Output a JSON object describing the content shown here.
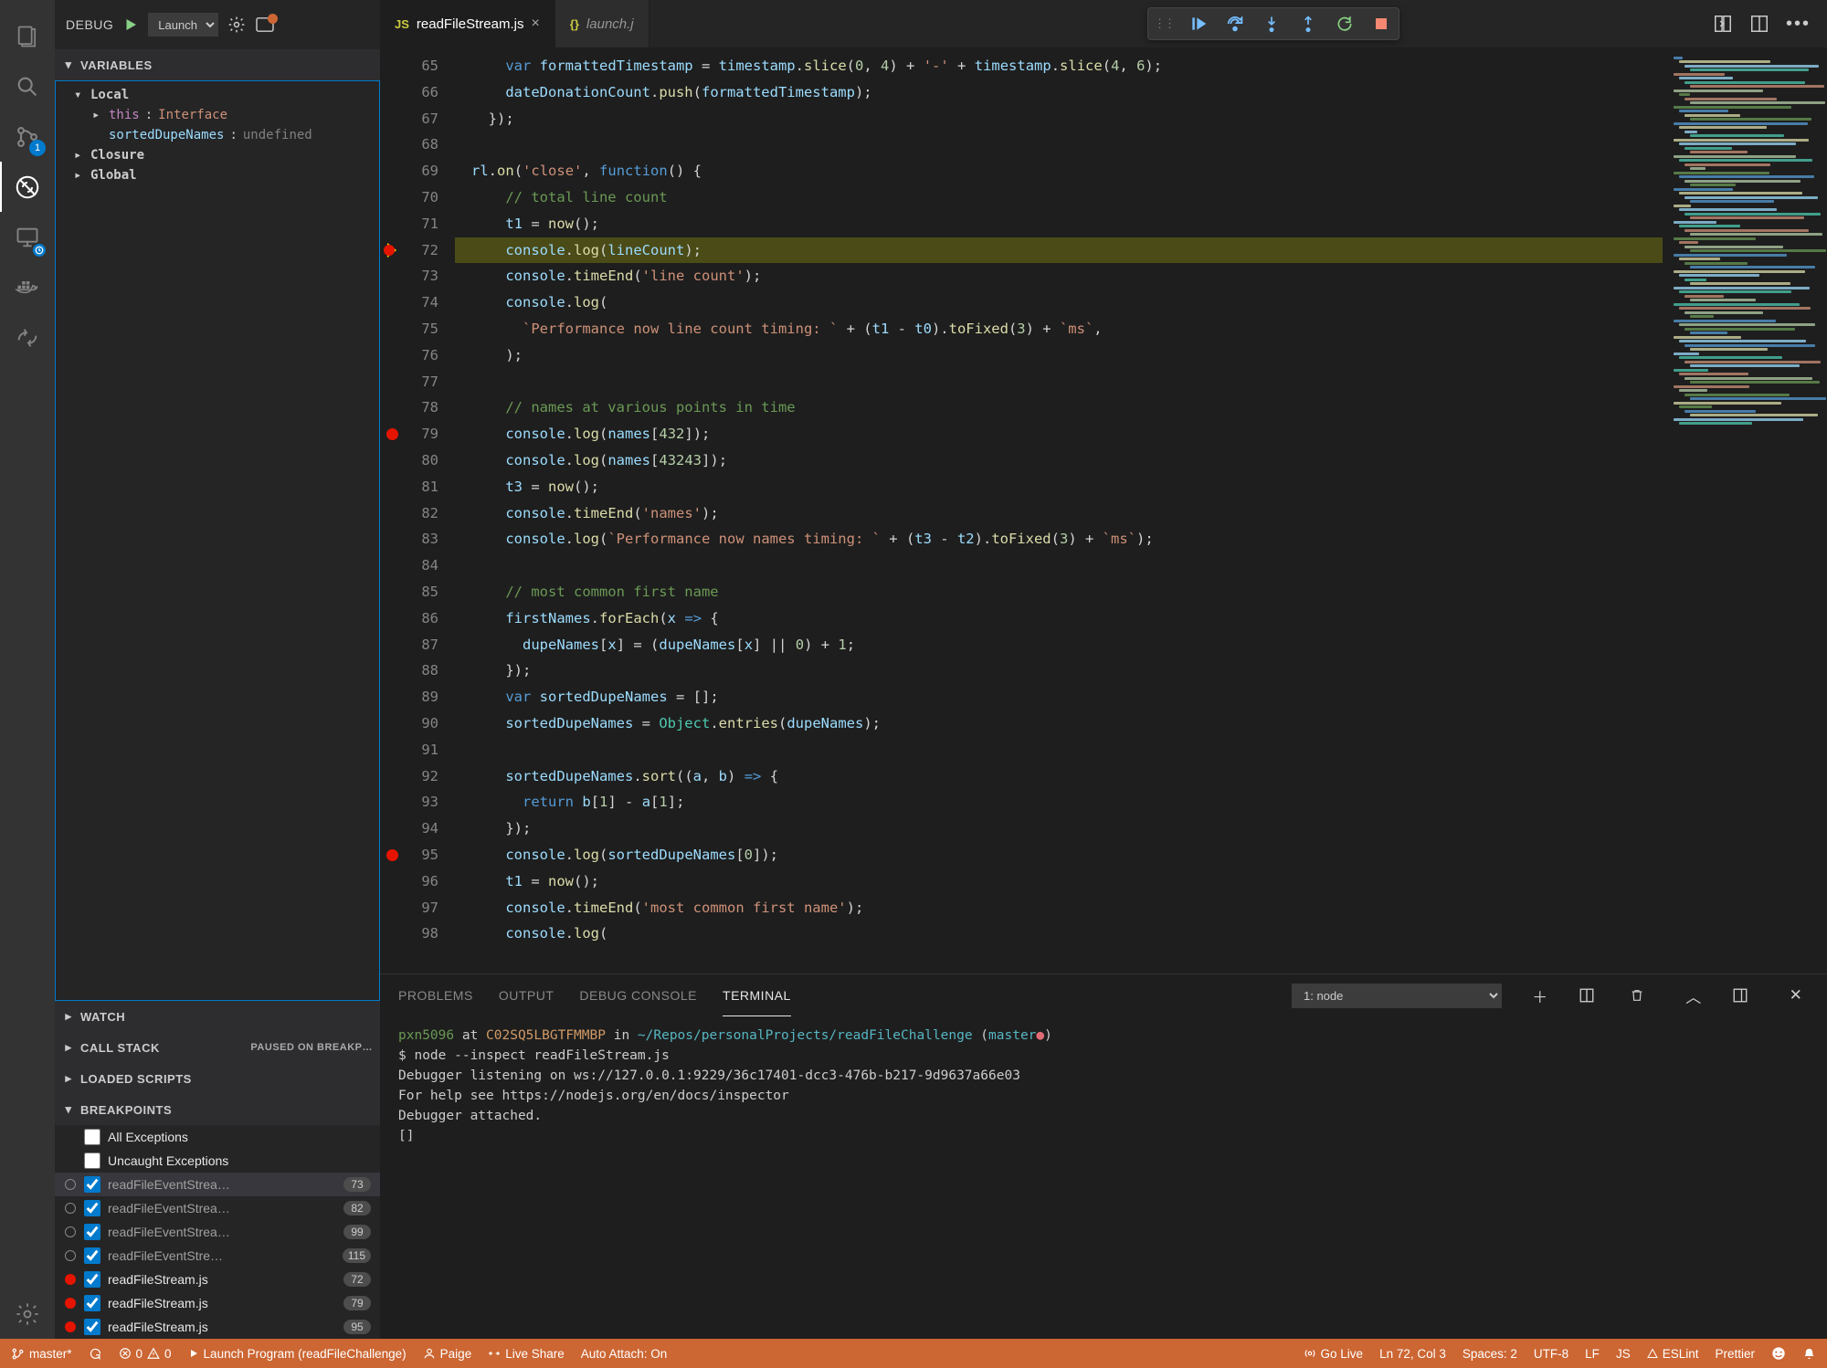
{
  "debugToolbar": {
    "label": "DEBUG",
    "config": "Launch",
    "iconGear": "gear",
    "iconBreak": "breakpoint"
  },
  "sections": {
    "variables": "VARIABLES",
    "watch": "WATCH",
    "callstack": "CALL STACK",
    "callstack_status": "PAUSED ON BREAKP…",
    "loaded": "LOADED SCRIPTS",
    "breakpoints": "BREAKPOINTS"
  },
  "variables": {
    "scopes": [
      {
        "name": "Local",
        "items": [
          {
            "k": "this",
            "v": "Interface",
            "kcls": "var-key2",
            "vcls": "var-val",
            "expandable": true
          },
          {
            "k": "sortedDupeNames",
            "v": "undefined",
            "kcls": "var-key",
            "vcls": "var-und",
            "expandable": false
          }
        ]
      },
      {
        "name": "Closure"
      },
      {
        "name": "Global"
      }
    ]
  },
  "bp_builtin": [
    {
      "label": "All Exceptions",
      "checked": false
    },
    {
      "label": "Uncaught Exceptions",
      "checked": false
    }
  ],
  "breakpoints": [
    {
      "file": "readFileEventStrea…",
      "line": "73",
      "dot": "hollow",
      "sel": true
    },
    {
      "file": "readFileEventStrea…",
      "line": "82",
      "dot": "hollow"
    },
    {
      "file": "readFileEventStrea…",
      "line": "99",
      "dot": "hollow"
    },
    {
      "file": "readFileEventStre…",
      "line": "115",
      "dot": "hollow"
    },
    {
      "file": "readFileStream.js",
      "line": "72",
      "dot": "red",
      "active": true
    },
    {
      "file": "readFileStream.js",
      "line": "79",
      "dot": "red",
      "active": true
    },
    {
      "file": "readFileStream.js",
      "line": "95",
      "dot": "red",
      "active": true
    }
  ],
  "tabs": [
    {
      "icon": "JS",
      "label": "readFileStream.js",
      "active": true,
      "close": true
    },
    {
      "icon": "{}",
      "label": "launch.j",
      "active": false
    }
  ],
  "debugControls": [
    "continue",
    "step-over",
    "step-into",
    "step-out",
    "restart",
    "stop"
  ],
  "lineStart": 65,
  "currentLine": 72,
  "bpLines": [
    79,
    95
  ],
  "code": [
    "    <span class='tok-kw'>var</span> <span class='tok-var'>formattedTimestamp</span> = <span class='tok-var'>timestamp</span>.<span class='tok-fn'>slice</span>(<span class='tok-num'>0</span>, <span class='tok-num'>4</span>) + <span class='tok-str'>'-'</span> + <span class='tok-var'>timestamp</span>.<span class='tok-fn'>slice</span>(<span class='tok-num'>4</span>, <span class='tok-num'>6</span>);",
    "    <span class='tok-var'>dateDonationCount</span>.<span class='tok-fn'>push</span>(<span class='tok-var'>formattedTimestamp</span>);",
    "  });",
    "",
    "<span class='tok-var'>rl</span>.<span class='tok-fn'>on</span>(<span class='tok-str'>'close'</span>, <span class='tok-kw'>function</span>() {",
    "    <span class='tok-com'>// total line count</span>",
    "    <span class='tok-var'>t1</span> = <span class='tok-fn'>now</span>();",
    "    <span class='tok-var'>console</span>.<span class='tok-fn'>log</span>(<span class='tok-var'>lineCount</span>);",
    "    <span class='tok-var'>console</span>.<span class='tok-fn'>timeEnd</span>(<span class='tok-str'>'line count'</span>);",
    "    <span class='tok-var'>console</span>.<span class='tok-fn'>log</span>(",
    "      <span class='tok-str'>`Performance now line count timing: `</span> + (<span class='tok-var'>t1</span> - <span class='tok-var'>t0</span>).<span class='tok-fn'>toFixed</span>(<span class='tok-num'>3</span>) + <span class='tok-str'>`ms`</span>,",
    "    );",
    "",
    "    <span class='tok-com'>// names at various points in time</span>",
    "    <span class='tok-var'>console</span>.<span class='tok-fn'>log</span>(<span class='tok-var'>names</span>[<span class='tok-num'>432</span>]);",
    "    <span class='tok-var'>console</span>.<span class='tok-fn'>log</span>(<span class='tok-var'>names</span>[<span class='tok-num'>43243</span>]);",
    "    <span class='tok-var'>t3</span> = <span class='tok-fn'>now</span>();",
    "    <span class='tok-var'>console</span>.<span class='tok-fn'>timeEnd</span>(<span class='tok-str'>'names'</span>);",
    "    <span class='tok-var'>console</span>.<span class='tok-fn'>log</span>(<span class='tok-str'>`Performance now names timing: `</span> + (<span class='tok-var'>t3</span> - <span class='tok-var'>t2</span>).<span class='tok-fn'>toFixed</span>(<span class='tok-num'>3</span>) + <span class='tok-str'>`ms`</span>);",
    "",
    "    <span class='tok-com'>// most common first name</span>",
    "    <span class='tok-var'>firstNames</span>.<span class='tok-fn'>forEach</span>(<span class='tok-var'>x</span> <span class='tok-arrow'>=&gt;</span> {",
    "      <span class='tok-var'>dupeNames</span>[<span class='tok-var'>x</span>] = (<span class='tok-var'>dupeNames</span>[<span class='tok-var'>x</span>] || <span class='tok-num'>0</span>) + <span class='tok-num'>1</span>;",
    "    });",
    "    <span class='tok-kw'>var</span> <span class='tok-var'>sortedDupeNames</span> = [];",
    "    <span class='tok-var'>sortedDupeNames</span> = <span class='tok-cls'>Object</span>.<span class='tok-fn'>entries</span>(<span class='tok-var'>dupeNames</span>);",
    "",
    "    <span class='tok-var'>sortedDupeNames</span>.<span class='tok-fn'>sort</span>((<span class='tok-var'>a</span>, <span class='tok-var'>b</span>) <span class='tok-arrow'>=&gt;</span> {",
    "      <span class='tok-kw'>return</span> <span class='tok-var'>b</span>[<span class='tok-num'>1</span>] - <span class='tok-var'>a</span>[<span class='tok-num'>1</span>];",
    "    });",
    "    <span class='tok-var'>console</span>.<span class='tok-fn'>log</span>(<span class='tok-var'>sortedDupeNames</span>[<span class='tok-num'>0</span>]);",
    "    <span class='tok-var'>t1</span> = <span class='tok-fn'>now</span>();",
    "    <span class='tok-var'>console</span>.<span class='tok-fn'>timeEnd</span>(<span class='tok-str'>'most common first name'</span>);",
    "    <span class='tok-var'>console</span>.<span class='tok-fn'>log</span>("
  ],
  "panelTabs": {
    "problems": "PROBLEMS",
    "output": "OUTPUT",
    "debug": "DEBUG CONSOLE",
    "terminal": "TERMINAL"
  },
  "terminalSelect": "1: node",
  "terminal": [
    {
      "html": "<span class='term-green'>pxn5096</span> at <span class='term-orange'>C02SQ5LBGTFMMBP</span> in <span class='term-cyan'>~/Repos/personalProjects/readFileChallenge</span> (<span class='term-cyan'>master</span><span class='term-red'>●</span>)"
    },
    {
      "html": "$ node --inspect readFileStream.js"
    },
    {
      "html": "Debugger listening on ws://127.0.0.1:9229/36c17401-dcc3-476b-b217-9d9637a66e03"
    },
    {
      "html": "For help see https://nodejs.org/en/docs/inspector"
    },
    {
      "html": "Debugger attached."
    },
    {
      "html": "[]"
    }
  ],
  "status": {
    "branch": "master*",
    "errors": "0",
    "warnings": "0",
    "launch": "Launch Program (readFileChallenge)",
    "user": "Paige",
    "liveshare": "Live Share",
    "autoAttach": "Auto Attach: On",
    "golive": "Go Live",
    "cursor": "Ln 72, Col 3",
    "spaces": "Spaces: 2",
    "encoding": "UTF-8",
    "eol": "LF",
    "lang": "JS",
    "eslint": "ESLint",
    "prettier": "Prettier"
  }
}
